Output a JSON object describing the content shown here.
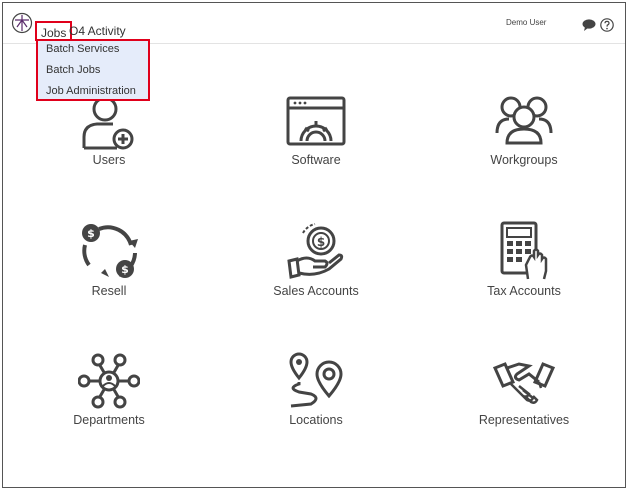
{
  "header": {
    "nav": {
      "jobs_label": "Jobs",
      "activity_label": "O4 Activity"
    },
    "user_name": "Demo User"
  },
  "dropdown": {
    "items": [
      "Batch Services",
      "Batch Jobs",
      "Job Administration"
    ]
  },
  "tiles": [
    {
      "label": "Users",
      "icon": "user-add-icon"
    },
    {
      "label": "Software",
      "icon": "browser-gear-icon"
    },
    {
      "label": "Workgroups",
      "icon": "group-icon"
    },
    {
      "label": "Resell",
      "icon": "dollar-cycle-icon"
    },
    {
      "label": "Sales Accounts",
      "icon": "hand-coin-icon"
    },
    {
      "label": "Tax Accounts",
      "icon": "calculator-icon"
    },
    {
      "label": "Departments",
      "icon": "network-icon"
    },
    {
      "label": "Locations",
      "icon": "map-pins-icon"
    },
    {
      "label": "Representatives",
      "icon": "handshake-icon"
    }
  ],
  "colors": {
    "highlight": "#e0001b",
    "dropdown_bg": "#e5ecfa",
    "icon": "#444444"
  }
}
